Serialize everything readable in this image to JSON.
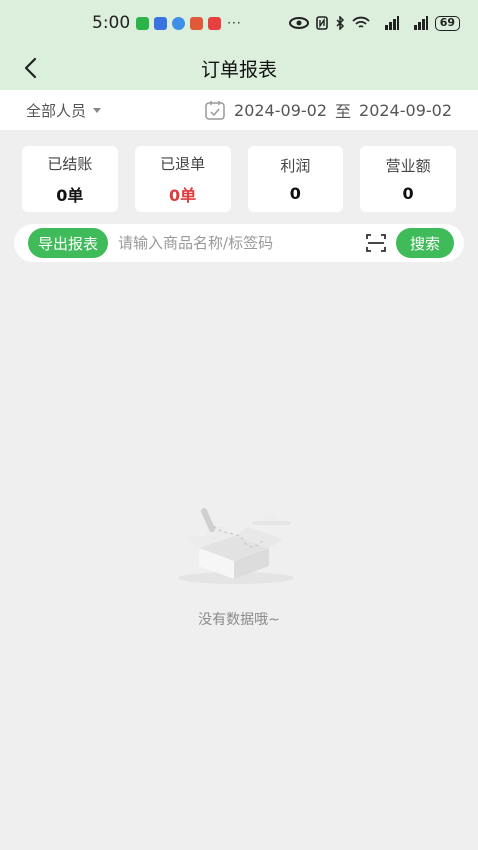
{
  "status_bar": {
    "time": "5:00",
    "dots": "···",
    "battery": "69"
  },
  "nav": {
    "title": "订单报表"
  },
  "filter": {
    "person": "全部人员",
    "start_date": "2024-09-02",
    "separator": "至",
    "end_date": "2024-09-02"
  },
  "stats": [
    {
      "label": "已结账",
      "value": "0单"
    },
    {
      "label": "已退单",
      "value": "0单"
    },
    {
      "label": "利润",
      "value": "0"
    },
    {
      "label": "营业额",
      "value": "0"
    }
  ],
  "search": {
    "export_label": "导出报表",
    "placeholder": "请输入商品名称/标签码",
    "search_label": "搜索"
  },
  "empty": {
    "text": "没有数据哦~"
  },
  "colors": {
    "accent": "#3fbb5a",
    "refund": "#e03a3a",
    "header_bg": "#dcefdc"
  }
}
